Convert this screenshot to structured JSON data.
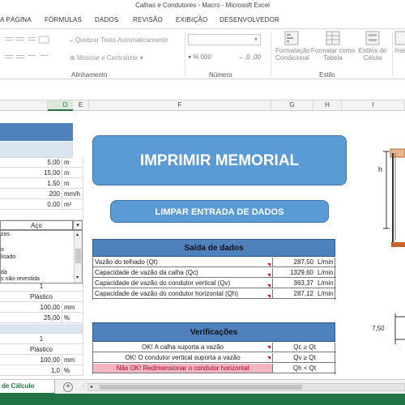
{
  "window": {
    "title": "Calhas e Condutores - Macro - Microsoft Excel"
  },
  "ribbon": {
    "tabs": [
      "A PÁGINA",
      "FÓRMULAS",
      "DADOS",
      "REVISÃO",
      "EXIBIÇÃO",
      "DESENVOLVEDOR"
    ],
    "wrap_text": "Quebrar Texto Automaticamente",
    "merge_center": "Mesclar e Centralizar",
    "group_alignment": "Alinhamento",
    "group_number": "Número",
    "number_symbols": "% 000",
    "decimals": "←,0  ,00",
    "cond_format_1": "Formatação",
    "cond_format_2": "Condicional",
    "format_table_1": "Formatar como",
    "format_table_2": "Tabela",
    "cell_styles_1": "Estilos de",
    "cell_styles_2": "Célula",
    "group_style": "Estilo",
    "insert_label": "Inse"
  },
  "columns": [
    "D",
    "E",
    "F",
    "G",
    "H",
    "I"
  ],
  "left_inputs": [
    {
      "value": "5,00",
      "unit": "m"
    },
    {
      "value": "15,00",
      "unit": "m"
    },
    {
      "value": "1,50",
      "unit": "m"
    },
    {
      "value": "200",
      "unit": "mm/h"
    },
    {
      "value": "0,00",
      "unit": "m²"
    }
  ],
  "material_select": {
    "value": "Aço"
  },
  "dropdown_items": [
    "zos",
    "",
    "o",
    "lisado",
    "",
    "da",
    "s não-revestida"
  ],
  "lower_inputs": {
    "plastico1": "Plástico",
    "v1": "100,00",
    "u1": "mm",
    "v2": "25,00",
    "u2": "%",
    "one_a": "1",
    "one_b": "1",
    "plastico2": "Plástico",
    "v3": "100,00",
    "u3": "mm",
    "v4": "1,0",
    "u4": "%"
  },
  "buttons": {
    "print": "IMPRIMIR MEMORIAL",
    "clear": "LIMPAR ENTRADA DE DADOS"
  },
  "output": {
    "title": "Saída de dados",
    "rows": [
      {
        "label": "Vazão do telhado (Qt)",
        "value": "287,50",
        "unit": "L/min"
      },
      {
        "label": "Capacidade de vazão da calha (Qc)",
        "value": "1329,60",
        "unit": "L/min"
      },
      {
        "label": "Capacidade de vazão do condutor vertical (Qv)",
        "value": "363,37",
        "unit": "L/min"
      },
      {
        "label": "Capacidade de vazão do condutor horizontal (Qh)",
        "value": "287,12",
        "unit": "L/min"
      }
    ]
  },
  "checks": {
    "title": "Verificações",
    "rows": [
      {
        "label": "OK! A calha suporta a vazão",
        "cond": "Qc ≥ Qt",
        "status": "ok"
      },
      {
        "label": "OK! O condutor vertical suporta a vazão",
        "cond": "Qv ≥ Qt",
        "status": "ok"
      },
      {
        "label": "Não OK! Redimensionar o condutor horizontal",
        "cond": "Qh < Qt",
        "status": "fail"
      }
    ]
  },
  "drawing": {
    "h_label": "h",
    "dim_label": "7,50"
  },
  "sheet_tabs": {
    "active": "de Cálculo",
    "add": "+"
  },
  "colors": {
    "excel_green": "#217346",
    "header_blue": "#4f81bd",
    "button_blue": "#5b9bd5",
    "fail_fill": "#f4b6c2"
  }
}
